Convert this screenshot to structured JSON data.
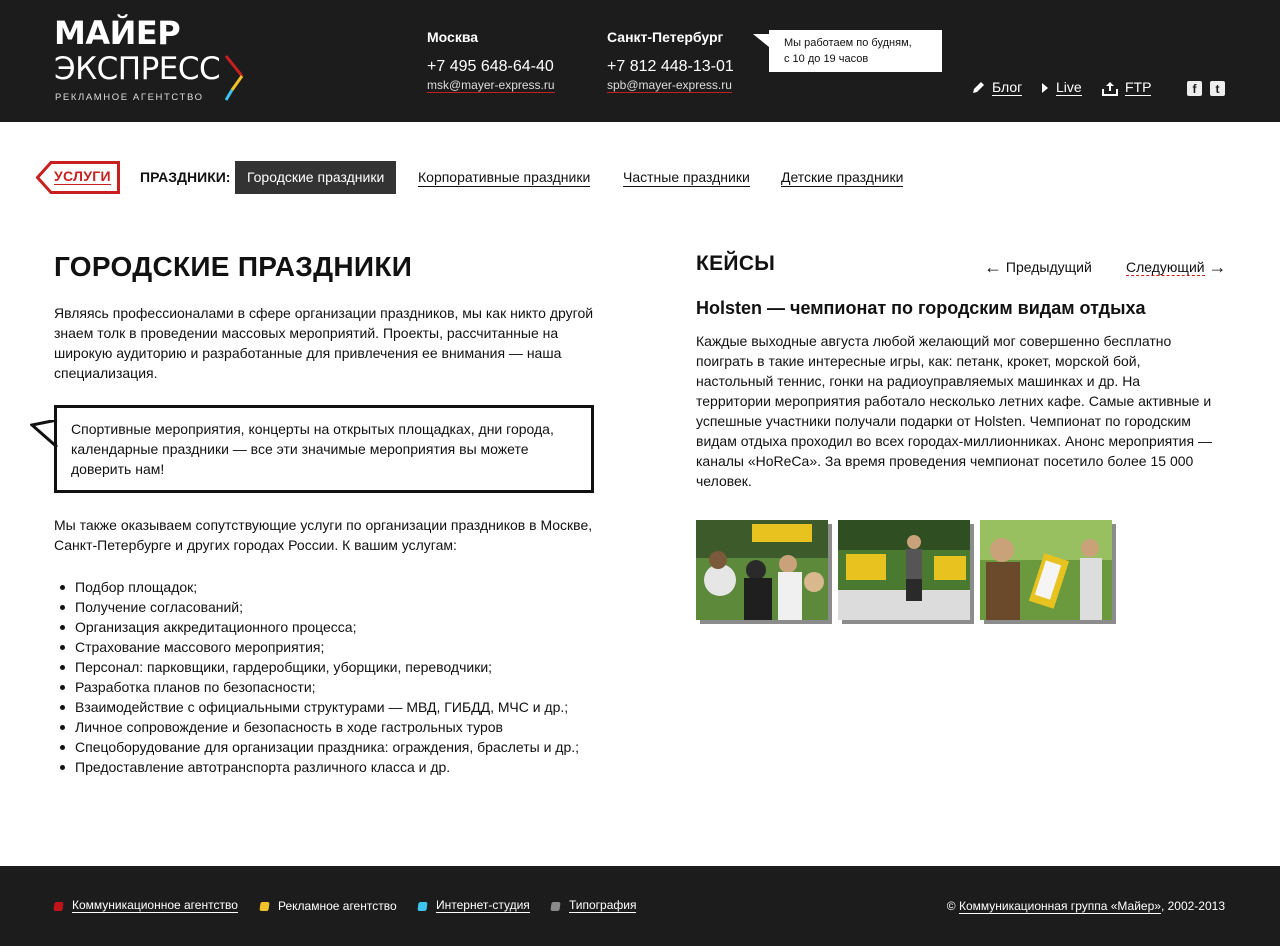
{
  "header": {
    "logo": {
      "line1": "МАЙЕР",
      "line2": "ЭКСПРЕСС",
      "tagline": "РЕКЛАМНОЕ АГЕНТСТВО"
    },
    "cities": [
      {
        "name": "Москва",
        "phone": "+7 495 648-64-40",
        "email": "msk@mayer-express.ru"
      },
      {
        "name": "Санкт-Петербург",
        "phone": "+7 812 448-13-01",
        "email": "spb@mayer-express.ru"
      }
    ],
    "worktime": {
      "line1": "Мы работаем по будням,",
      "line2": "с 10 до 19 часов"
    },
    "links": [
      {
        "label": "Блог",
        "icon": "pencil-icon"
      },
      {
        "label": "Live",
        "icon": "play-icon"
      },
      {
        "label": "FTP",
        "icon": "upload-icon"
      }
    ],
    "social": [
      {
        "icon": "facebook-icon",
        "glyph": "f"
      },
      {
        "icon": "twitter-icon",
        "glyph": "t"
      }
    ]
  },
  "nav": {
    "back_label": "УСЛУГИ",
    "section_label": "ПРАЗДНИКИ:",
    "items": [
      {
        "label": "Городские праздники",
        "active": true
      },
      {
        "label": "Корпоративные праздники",
        "active": false
      },
      {
        "label": "Частные праздники",
        "active": false
      },
      {
        "label": "Детские праздники",
        "active": false
      }
    ]
  },
  "main": {
    "title": "ГОРОДСКИЕ ПРАЗДНИКИ",
    "intro": [
      "Являясь профессионалами в сфере организации праздников, мы как никто другой",
      "знаем толк в проведении массовых мероприятий. Проекты, рассчитанные на",
      "широкую аудиторию и разработанные для привлечения ее внимания — наша",
      "специализация."
    ],
    "quote": [
      "Спортивные мероприятия, концерты на открытых площадках, дни города,",
      "календарные праздники — все эти значимые мероприятия вы можете",
      "доверить нам!"
    ],
    "services_intro": [
      "Мы также оказываем сопутствующие услуги по организации праздников в Москве,",
      "Санкт-Петербурге и других городах России. К вашим услугам:"
    ],
    "services": [
      "Подбор площадок;",
      "Получение согласований;",
      "Организация аккредитационного процесса;",
      "Страхование массового мероприятия;",
      "Персонал: парковщики, гардеробщики, уборщики, переводчики;",
      "Разработка планов по безопасности;",
      "Взаимодействие с официальными структурами — МВД, ГИБДД, МЧС и др.;",
      "Личное сопровождение и безопасность в ходе гастрольных туров",
      "Спецоборудование для организации праздника: ограждения, браслеты и др.;",
      "Предоставление автотранспорта различного класса и др."
    ]
  },
  "cases": {
    "title": "КЕЙСЫ",
    "prev_label": "Предыдущий",
    "next_label": "Следующий",
    "case_title": "Holsten — чемпионат по городским видам отдыха",
    "case_text": [
      "Каждые выходные августа любой желающий мог совершенно бесплатно",
      "поиграть в такие интересные игры, как: петанк, крокет, морской бой,",
      "настольный теннис, гонки на радиоуправляемых машинках и др. На",
      "территории мероприятия работало несколько летних кафе. Самые активные и",
      "успешные участники получали подарки от Holsten. Чемпионат по городским",
      "видам отдыха проходил во всех городах-миллионниках. Анонс мероприятия —",
      "каналы «HoReCa». За время проведения чемпионат посетило более 15 000",
      "человек."
    ]
  },
  "footer": {
    "links": [
      {
        "label": "Коммуникационное агентство",
        "color": "#c0141b",
        "underlined": true
      },
      {
        "label": "Рекламное агентство",
        "color": "#f2c22c",
        "underlined": false
      },
      {
        "label": "Интернет-студия",
        "color": "#3cc3ee",
        "underlined": true
      },
      {
        "label": "Типография",
        "color": "#8a8a8a",
        "underlined": true
      }
    ],
    "copyright_prefix": "©",
    "copyright_link": "Коммуникационная группа «Майер»",
    "copyright_suffix": ", 2002-2013"
  },
  "colors": {
    "header_bg": "#1c1c1c",
    "accent_red": "#c8201f",
    "active_nav_bg": "#333333"
  }
}
